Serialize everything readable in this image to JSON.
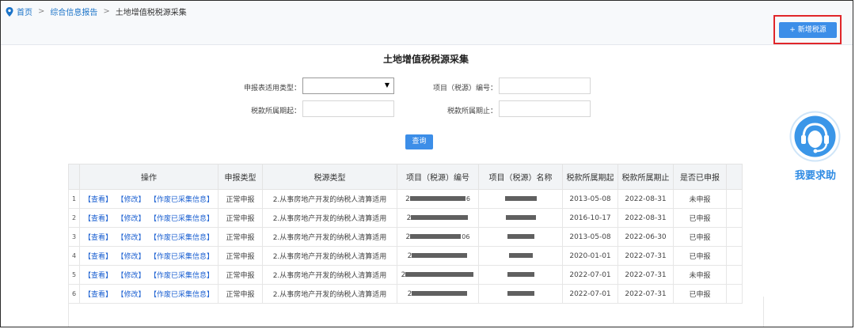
{
  "breadcrumb": {
    "home": "首页",
    "sep": ">",
    "level2": "综合信息报告",
    "current": "土地增值税税源采集"
  },
  "toolbar": {
    "add_label": "+ 新增税源"
  },
  "page": {
    "title": "土地增值税税源采集"
  },
  "form": {
    "report_type_label": "申报表适用类型：",
    "report_type_value": "",
    "project_no_label": "项目（税源）编号：",
    "period_start_label": "税款所属期起：",
    "period_end_label": "税款所属期止：",
    "query_label": "查询"
  },
  "table": {
    "headers": [
      "操作",
      "申报类型",
      "税源类型",
      "项目（税源）编号",
      "项目（税源）名称",
      "税款所属期起",
      "税款所属期止",
      "是否已申报"
    ],
    "op_labels": {
      "view": "【查看】",
      "edit": "【修改】",
      "void": "【作废已采集信息】"
    },
    "rows": [
      {
        "index": "1",
        "type": "正常申报",
        "source_type": "2.从事房地产开发的纳税人清算适用",
        "code_prefix": "2",
        "code_suffix": "6",
        "start": "2013-05-08",
        "end": "2022-08-31",
        "declared": "未申报"
      },
      {
        "index": "2",
        "type": "正常申报",
        "source_type": "2.从事房地产开发的纳税人清算适用",
        "code_prefix": "2",
        "code_suffix": "",
        "start": "2016-10-17",
        "end": "2022-08-31",
        "declared": "已申报"
      },
      {
        "index": "3",
        "type": "正常申报",
        "source_type": "2.从事房地产开发的纳税人清算适用",
        "code_prefix": "2",
        "code_suffix": "06",
        "start": "2013-05-08",
        "end": "2022-06-30",
        "declared": "已申报"
      },
      {
        "index": "4",
        "type": "正常申报",
        "source_type": "2.从事房地产开发的纳税人清算适用",
        "code_prefix": "2",
        "code_suffix": "",
        "start": "2020-01-01",
        "end": "2022-07-31",
        "declared": "已申报"
      },
      {
        "index": "5",
        "type": "正常申报",
        "source_type": "2.从事房地产开发的纳税人清算适用",
        "code_prefix": "2",
        "code_suffix": "",
        "start": "2022-07-01",
        "end": "2022-07-31",
        "declared": "未申报"
      },
      {
        "index": "6",
        "type": "正常申报",
        "source_type": "2.从事房地产开发的纳税人清算适用",
        "code_prefix": "2",
        "code_suffix": "",
        "start": "2022-07-01",
        "end": "2022-07-31",
        "declared": "已申报"
      }
    ]
  },
  "help": {
    "label": "我要求助",
    "icon": "headset-icon"
  },
  "colors": {
    "accent": "#3c8ee8",
    "link": "#1a5fd1",
    "highlight_box": "#e0262a",
    "help": "#2f8be3"
  }
}
